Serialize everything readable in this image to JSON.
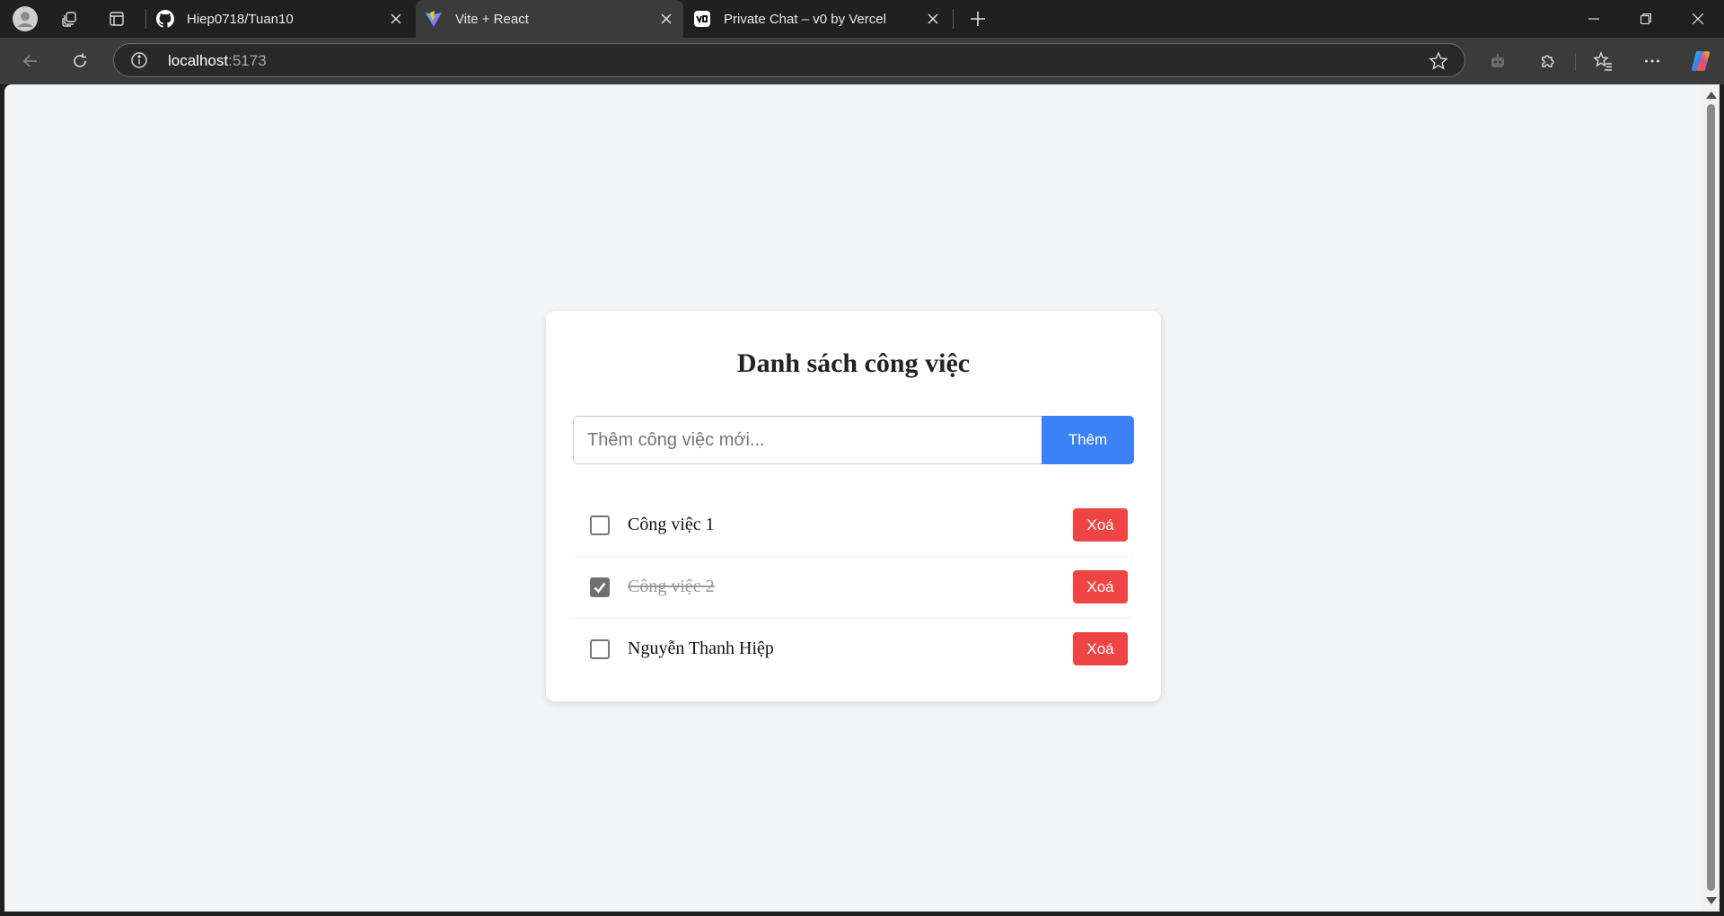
{
  "browser": {
    "tabs": [
      {
        "title": "Hiep0718/Tuan10",
        "favicon": "github-icon",
        "active": false
      },
      {
        "title": "Vite + React",
        "favicon": "vite-icon",
        "active": true
      },
      {
        "title": "Private Chat – v0 by Vercel",
        "favicon": "v0-icon",
        "active": false
      }
    ],
    "address": {
      "host": "localhost",
      "port": ":5173"
    }
  },
  "app": {
    "title": "Danh sách công việc",
    "input": {
      "placeholder": "Thêm công việc mới...",
      "value": ""
    },
    "add_label": "Thêm",
    "todos": [
      {
        "text": "Công việc 1",
        "done": false,
        "delete_label": "Xoá"
      },
      {
        "text": "Công việc 2",
        "done": true,
        "delete_label": "Xoá"
      },
      {
        "text": "Nguyễn Thanh Hiệp",
        "done": false,
        "delete_label": "Xoá"
      }
    ]
  },
  "colors": {
    "accent": "#3b82f6",
    "danger": "#ef4444",
    "page_bg": "#f3f4f6"
  }
}
